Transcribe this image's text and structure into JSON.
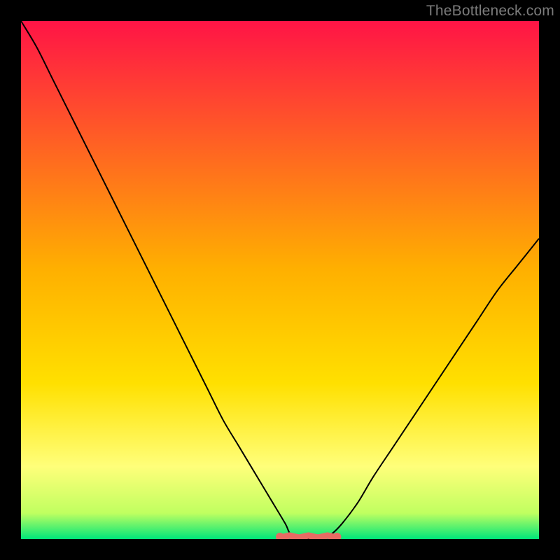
{
  "watermark": "TheBottleneck.com",
  "colors": {
    "frame_bg": "#000000",
    "gradient_top": "#ff1446",
    "gradient_mid": "#ffd000",
    "gradient_low": "#ffff7a",
    "gradient_bottom": "#00e57a",
    "curve": "#000000",
    "highlight": "#e86a63"
  },
  "chart_data": {
    "type": "line",
    "title": "",
    "xlabel": "",
    "ylabel": "",
    "xlim": [
      0,
      100
    ],
    "ylim": [
      0,
      100
    ],
    "x": [
      0,
      3,
      6,
      9,
      12,
      15,
      18,
      21,
      24,
      27,
      30,
      33,
      36,
      39,
      42,
      45,
      48,
      51,
      52,
      54,
      56,
      58,
      60,
      62,
      65,
      68,
      72,
      76,
      80,
      84,
      88,
      92,
      96,
      100
    ],
    "values": [
      100,
      95,
      89,
      83,
      77,
      71,
      65,
      59,
      53,
      47,
      41,
      35,
      29,
      23,
      18,
      13,
      8,
      3,
      1,
      0,
      0,
      0,
      1,
      3,
      7,
      12,
      18,
      24,
      30,
      36,
      42,
      48,
      53,
      58
    ],
    "highlight_region": {
      "x_start": 50,
      "x_end": 61,
      "y": 0
    }
  }
}
